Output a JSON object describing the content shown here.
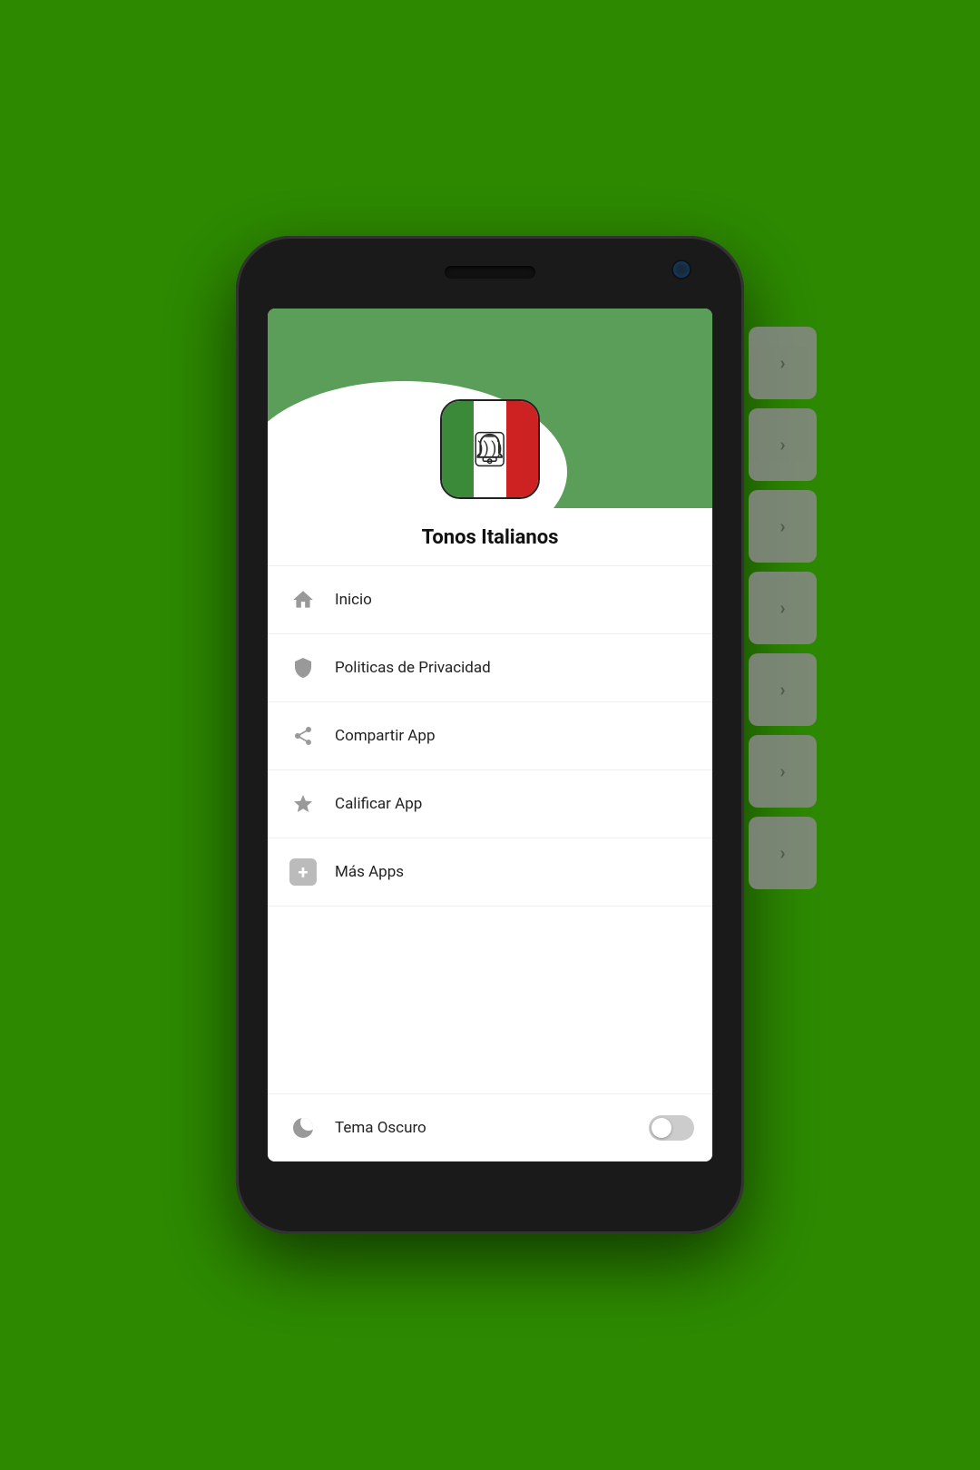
{
  "app": {
    "title": "Tonos Italianos",
    "background_color": "#2d8a00",
    "header_color": "#5a9e5a"
  },
  "menu": {
    "items": [
      {
        "id": "inicio",
        "label": "Inicio",
        "icon": "home-icon"
      },
      {
        "id": "privacidad",
        "label": "Politicas de Privacidad",
        "icon": "shield-icon"
      },
      {
        "id": "compartir",
        "label": "Compartir App",
        "icon": "share-icon"
      },
      {
        "id": "calificar",
        "label": "Calificar App",
        "icon": "star-icon"
      },
      {
        "id": "mas-apps",
        "label": "Más Apps",
        "icon": "plus-icon"
      }
    ],
    "toggle": {
      "label": "Tema Oscuro",
      "icon": "moon-icon",
      "enabled": false
    }
  },
  "side_cards": [
    {
      "arrow": "›"
    },
    {
      "arrow": "›"
    },
    {
      "arrow": "›"
    },
    {
      "arrow": "›"
    },
    {
      "arrow": "›"
    },
    {
      "arrow": "›"
    },
    {
      "arrow": "›"
    }
  ]
}
